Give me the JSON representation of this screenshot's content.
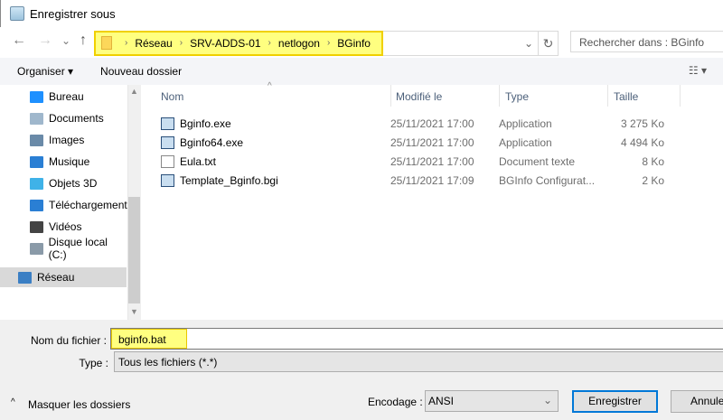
{
  "window": {
    "title": "Enregistrer sous"
  },
  "nav": {
    "back": "←",
    "forward": "→",
    "recent": "⌄",
    "up": "↑",
    "breadcrumbs": [
      "Réseau",
      "SRV-ADDS-01",
      "netlogon",
      "BGinfo"
    ],
    "refresh": "↻",
    "search_placeholder": "Rechercher dans : BGinfo"
  },
  "toolbar": {
    "organize": "Organiser ▾",
    "new_folder": "Nouveau dossier",
    "view": "☷ ▾"
  },
  "sidebar": {
    "items": [
      {
        "label": "Bureau",
        "color": "#1e90ff"
      },
      {
        "label": "Documents",
        "color": "#9fb7cc"
      },
      {
        "label": "Images",
        "color": "#6a8aa8"
      },
      {
        "label": "Musique",
        "color": "#2a7fd4"
      },
      {
        "label": "Objets 3D",
        "color": "#3fb2e8"
      },
      {
        "label": "Téléchargement",
        "color": "#2a7fd4"
      },
      {
        "label": "Vidéos",
        "color": "#444"
      },
      {
        "label": "Disque local (C:)",
        "color": "#8a9aa8"
      }
    ],
    "network": "Réseau"
  },
  "columns": {
    "name": "Nom",
    "modified": "Modifié le",
    "type": "Type",
    "size": "Taille"
  },
  "files": [
    {
      "name": "Bginfo.exe",
      "modified": "25/11/2021 17:00",
      "type": "Application",
      "size": "3 275 Ko"
    },
    {
      "name": "Bginfo64.exe",
      "modified": "25/11/2021 17:00",
      "type": "Application",
      "size": "4 494 Ko"
    },
    {
      "name": "Eula.txt",
      "modified": "25/11/2021 17:00",
      "type": "Document texte",
      "size": "8 Ko"
    },
    {
      "name": "Template_Bginfo.bgi",
      "modified": "25/11/2021 17:09",
      "type": "BGInfo Configurat...",
      "size": "2 Ko"
    }
  ],
  "form": {
    "filename_label": "Nom du fichier :",
    "filename": "bginfo.bat",
    "type_label": "Type :",
    "type": "Tous les fichiers  (*.*)",
    "encoding_label": "Encodage :",
    "encoding": "ANSI",
    "hide_folders": "Masquer les dossiers",
    "save": "Enregistrer",
    "cancel": "Annuler"
  }
}
